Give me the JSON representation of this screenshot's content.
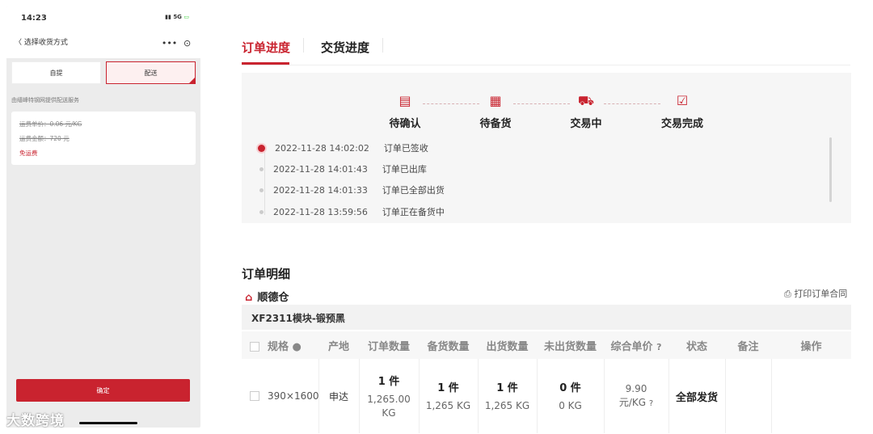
{
  "phone": {
    "time": "14:23",
    "signal": "5G",
    "nav_title": "〈 选择收货方式",
    "capsule_more": "•••",
    "capsule_close": "⊙",
    "seg_pickup": "自提",
    "seg_delivery": "配送",
    "provider_note": "由缙峰特钢网提供配送服务",
    "fee_unit_price": "运费单价：0.06 元/KG",
    "fee_total": "运费金额：720 元",
    "fee_free": "免运费",
    "confirm_label": "确定",
    "watermark": "大数跨境"
  },
  "tabs": [
    {
      "label": "订单进度"
    },
    {
      "label": "交货进度"
    }
  ],
  "steps": [
    {
      "label": "待确认",
      "icon": "pending-confirm-icon",
      "glyph": "▤"
    },
    {
      "label": "待备货",
      "icon": "stock-icon",
      "glyph": "▦"
    },
    {
      "label": "交易中",
      "icon": "truck-icon",
      "glyph": "⛟"
    },
    {
      "label": "交易完成",
      "icon": "complete-icon",
      "glyph": "☑"
    }
  ],
  "timeline": [
    {
      "time": "2022-11-28 14:02:02",
      "msg": "订单已签收"
    },
    {
      "time": "2022-11-28 14:01:43",
      "msg": "订单已出库"
    },
    {
      "time": "2022-11-28 14:01:33",
      "msg": "订单已全部出货"
    },
    {
      "time": "2022-11-28 13:59:56",
      "msg": "订单正在备货中"
    }
  ],
  "detail": {
    "title": "订单明细",
    "warehouse": "顺德仓",
    "print_label": "打印订单合同",
    "product": "XF2311模块-锻预黑"
  },
  "table": {
    "headers": [
      "规格",
      "产地",
      "订单数量",
      "备货数量",
      "出货数量",
      "未出货数量",
      "综合单价",
      "状态",
      "备注",
      "操作"
    ],
    "row": {
      "spec": "390×1600",
      "origin": "申达",
      "order_qty": "1 件",
      "order_weight": "1,265.00 KG",
      "stock_qty": "1 件",
      "stock_weight": "1,265 KG",
      "ship_qty": "1 件",
      "ship_weight": "1,265 KG",
      "unship_qty": "0 件",
      "unship_weight": "0 KG",
      "price": "9.90",
      "price_unit": "元/KG",
      "status": "全部发货",
      "note": "",
      "action": ""
    }
  },
  "colors": {
    "accent": "#c9232f"
  }
}
